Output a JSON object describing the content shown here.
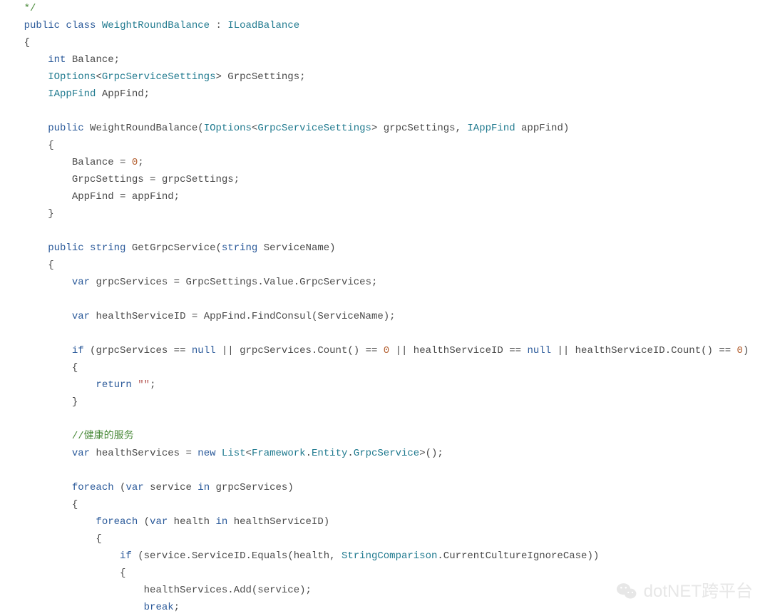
{
  "code": {
    "lines": [
      {
        "indent": "    ",
        "spans": [
          {
            "cls": "cmt",
            "t": "*/"
          }
        ]
      },
      {
        "indent": "    ",
        "spans": [
          {
            "cls": "kw",
            "t": "public"
          },
          {
            "cls": "punct",
            "t": " "
          },
          {
            "cls": "kw",
            "t": "class"
          },
          {
            "cls": "punct",
            "t": " "
          },
          {
            "cls": "type",
            "t": "WeightRoundBalance"
          },
          {
            "cls": "punct",
            "t": " : "
          },
          {
            "cls": "type",
            "t": "ILoadBalance"
          }
        ]
      },
      {
        "indent": "    ",
        "spans": [
          {
            "cls": "punct",
            "t": "{"
          }
        ]
      },
      {
        "indent": "        ",
        "spans": [
          {
            "cls": "kw",
            "t": "int"
          },
          {
            "cls": "punct",
            "t": " "
          },
          {
            "cls": "ident",
            "t": "Balance"
          },
          {
            "cls": "punct",
            "t": ";"
          }
        ]
      },
      {
        "indent": "        ",
        "spans": [
          {
            "cls": "type",
            "t": "IOptions"
          },
          {
            "cls": "punct",
            "t": "<"
          },
          {
            "cls": "type",
            "t": "GrpcServiceSettings"
          },
          {
            "cls": "punct",
            "t": "> "
          },
          {
            "cls": "ident",
            "t": "GrpcSettings"
          },
          {
            "cls": "punct",
            "t": ";"
          }
        ]
      },
      {
        "indent": "        ",
        "spans": [
          {
            "cls": "type",
            "t": "IAppFind"
          },
          {
            "cls": "punct",
            "t": " "
          },
          {
            "cls": "ident",
            "t": "AppFind"
          },
          {
            "cls": "punct",
            "t": ";"
          }
        ]
      },
      {
        "indent": "",
        "spans": []
      },
      {
        "indent": "        ",
        "spans": [
          {
            "cls": "kw",
            "t": "public"
          },
          {
            "cls": "punct",
            "t": " "
          },
          {
            "cls": "ident",
            "t": "WeightRoundBalance"
          },
          {
            "cls": "punct",
            "t": "("
          },
          {
            "cls": "type",
            "t": "IOptions"
          },
          {
            "cls": "punct",
            "t": "<"
          },
          {
            "cls": "type",
            "t": "GrpcServiceSettings"
          },
          {
            "cls": "punct",
            "t": "> "
          },
          {
            "cls": "ident",
            "t": "grpcSettings"
          },
          {
            "cls": "punct",
            "t": ", "
          },
          {
            "cls": "type",
            "t": "IAppFind"
          },
          {
            "cls": "punct",
            "t": " "
          },
          {
            "cls": "ident",
            "t": "appFind"
          },
          {
            "cls": "punct",
            "t": ")"
          }
        ]
      },
      {
        "indent": "        ",
        "spans": [
          {
            "cls": "punct",
            "t": "{"
          }
        ]
      },
      {
        "indent": "            ",
        "spans": [
          {
            "cls": "ident",
            "t": "Balance"
          },
          {
            "cls": "punct",
            "t": " = "
          },
          {
            "cls": "num",
            "t": "0"
          },
          {
            "cls": "punct",
            "t": ";"
          }
        ]
      },
      {
        "indent": "            ",
        "spans": [
          {
            "cls": "ident",
            "t": "GrpcSettings"
          },
          {
            "cls": "punct",
            "t": " = "
          },
          {
            "cls": "ident",
            "t": "grpcSettings"
          },
          {
            "cls": "punct",
            "t": ";"
          }
        ]
      },
      {
        "indent": "            ",
        "spans": [
          {
            "cls": "ident",
            "t": "AppFind"
          },
          {
            "cls": "punct",
            "t": " = "
          },
          {
            "cls": "ident",
            "t": "appFind"
          },
          {
            "cls": "punct",
            "t": ";"
          }
        ]
      },
      {
        "indent": "        ",
        "spans": [
          {
            "cls": "punct",
            "t": "}"
          }
        ]
      },
      {
        "indent": "",
        "spans": []
      },
      {
        "indent": "        ",
        "spans": [
          {
            "cls": "kw",
            "t": "public"
          },
          {
            "cls": "punct",
            "t": " "
          },
          {
            "cls": "kw",
            "t": "string"
          },
          {
            "cls": "punct",
            "t": " "
          },
          {
            "cls": "ident",
            "t": "GetGrpcService"
          },
          {
            "cls": "punct",
            "t": "("
          },
          {
            "cls": "kw",
            "t": "string"
          },
          {
            "cls": "punct",
            "t": " "
          },
          {
            "cls": "ident",
            "t": "ServiceName"
          },
          {
            "cls": "punct",
            "t": ")"
          }
        ]
      },
      {
        "indent": "        ",
        "spans": [
          {
            "cls": "punct",
            "t": "{"
          }
        ]
      },
      {
        "indent": "            ",
        "spans": [
          {
            "cls": "kw",
            "t": "var"
          },
          {
            "cls": "punct",
            "t": " "
          },
          {
            "cls": "ident",
            "t": "grpcServices"
          },
          {
            "cls": "punct",
            "t": " = "
          },
          {
            "cls": "ident",
            "t": "GrpcSettings"
          },
          {
            "cls": "punct",
            "t": "."
          },
          {
            "cls": "ident",
            "t": "Value"
          },
          {
            "cls": "punct",
            "t": "."
          },
          {
            "cls": "ident",
            "t": "GrpcServices"
          },
          {
            "cls": "punct",
            "t": ";"
          }
        ]
      },
      {
        "indent": "",
        "spans": []
      },
      {
        "indent": "            ",
        "spans": [
          {
            "cls": "kw",
            "t": "var"
          },
          {
            "cls": "punct",
            "t": " "
          },
          {
            "cls": "ident",
            "t": "healthServiceID"
          },
          {
            "cls": "punct",
            "t": " = "
          },
          {
            "cls": "ident",
            "t": "AppFind"
          },
          {
            "cls": "punct",
            "t": "."
          },
          {
            "cls": "ident",
            "t": "FindConsul"
          },
          {
            "cls": "punct",
            "t": "("
          },
          {
            "cls": "ident",
            "t": "ServiceName"
          },
          {
            "cls": "punct",
            "t": ");"
          }
        ]
      },
      {
        "indent": "",
        "spans": []
      },
      {
        "indent": "            ",
        "spans": [
          {
            "cls": "kw",
            "t": "if"
          },
          {
            "cls": "punct",
            "t": " ("
          },
          {
            "cls": "ident",
            "t": "grpcServices"
          },
          {
            "cls": "punct",
            "t": " == "
          },
          {
            "cls": "kw",
            "t": "null"
          },
          {
            "cls": "punct",
            "t": " || "
          },
          {
            "cls": "ident",
            "t": "grpcServices"
          },
          {
            "cls": "punct",
            "t": "."
          },
          {
            "cls": "ident",
            "t": "Count"
          },
          {
            "cls": "punct",
            "t": "() == "
          },
          {
            "cls": "num",
            "t": "0"
          },
          {
            "cls": "punct",
            "t": " || "
          },
          {
            "cls": "ident",
            "t": "healthServiceID"
          },
          {
            "cls": "punct",
            "t": " == "
          },
          {
            "cls": "kw",
            "t": "null"
          },
          {
            "cls": "punct",
            "t": " || "
          },
          {
            "cls": "ident",
            "t": "healthServiceID"
          },
          {
            "cls": "punct",
            "t": "."
          },
          {
            "cls": "ident",
            "t": "Count"
          },
          {
            "cls": "punct",
            "t": "() == "
          },
          {
            "cls": "num",
            "t": "0"
          },
          {
            "cls": "punct",
            "t": ")"
          }
        ]
      },
      {
        "indent": "            ",
        "spans": [
          {
            "cls": "punct",
            "t": "{"
          }
        ]
      },
      {
        "indent": "                ",
        "spans": [
          {
            "cls": "kw",
            "t": "return"
          },
          {
            "cls": "punct",
            "t": " "
          },
          {
            "cls": "str",
            "t": "\"\""
          },
          {
            "cls": "punct",
            "t": ";"
          }
        ]
      },
      {
        "indent": "            ",
        "spans": [
          {
            "cls": "punct",
            "t": "}"
          }
        ]
      },
      {
        "indent": "",
        "spans": []
      },
      {
        "indent": "            ",
        "spans": [
          {
            "cls": "cmt",
            "t": "//健康的服务"
          }
        ]
      },
      {
        "indent": "            ",
        "spans": [
          {
            "cls": "kw",
            "t": "var"
          },
          {
            "cls": "punct",
            "t": " "
          },
          {
            "cls": "ident",
            "t": "healthServices"
          },
          {
            "cls": "punct",
            "t": " = "
          },
          {
            "cls": "kw",
            "t": "new"
          },
          {
            "cls": "punct",
            "t": " "
          },
          {
            "cls": "type",
            "t": "List"
          },
          {
            "cls": "punct",
            "t": "<"
          },
          {
            "cls": "type",
            "t": "Framework"
          },
          {
            "cls": "punct",
            "t": "."
          },
          {
            "cls": "type",
            "t": "Entity"
          },
          {
            "cls": "punct",
            "t": "."
          },
          {
            "cls": "type",
            "t": "GrpcService"
          },
          {
            "cls": "punct",
            "t": ">();"
          }
        ]
      },
      {
        "indent": "",
        "spans": []
      },
      {
        "indent": "            ",
        "spans": [
          {
            "cls": "kw",
            "t": "foreach"
          },
          {
            "cls": "punct",
            "t": " ("
          },
          {
            "cls": "kw",
            "t": "var"
          },
          {
            "cls": "punct",
            "t": " "
          },
          {
            "cls": "ident",
            "t": "service"
          },
          {
            "cls": "punct",
            "t": " "
          },
          {
            "cls": "kw",
            "t": "in"
          },
          {
            "cls": "punct",
            "t": " "
          },
          {
            "cls": "ident",
            "t": "grpcServices"
          },
          {
            "cls": "punct",
            "t": ")"
          }
        ]
      },
      {
        "indent": "            ",
        "spans": [
          {
            "cls": "punct",
            "t": "{"
          }
        ]
      },
      {
        "indent": "                ",
        "spans": [
          {
            "cls": "kw",
            "t": "foreach"
          },
          {
            "cls": "punct",
            "t": " ("
          },
          {
            "cls": "kw",
            "t": "var"
          },
          {
            "cls": "punct",
            "t": " "
          },
          {
            "cls": "ident",
            "t": "health"
          },
          {
            "cls": "punct",
            "t": " "
          },
          {
            "cls": "kw",
            "t": "in"
          },
          {
            "cls": "punct",
            "t": " "
          },
          {
            "cls": "ident",
            "t": "healthServiceID"
          },
          {
            "cls": "punct",
            "t": ")"
          }
        ]
      },
      {
        "indent": "                ",
        "spans": [
          {
            "cls": "punct",
            "t": "{"
          }
        ]
      },
      {
        "indent": "                    ",
        "spans": [
          {
            "cls": "kw",
            "t": "if"
          },
          {
            "cls": "punct",
            "t": " ("
          },
          {
            "cls": "ident",
            "t": "service"
          },
          {
            "cls": "punct",
            "t": "."
          },
          {
            "cls": "ident",
            "t": "ServiceID"
          },
          {
            "cls": "punct",
            "t": "."
          },
          {
            "cls": "ident",
            "t": "Equals"
          },
          {
            "cls": "punct",
            "t": "("
          },
          {
            "cls": "ident",
            "t": "health"
          },
          {
            "cls": "punct",
            "t": ", "
          },
          {
            "cls": "type",
            "t": "StringComparison"
          },
          {
            "cls": "punct",
            "t": "."
          },
          {
            "cls": "ident",
            "t": "CurrentCultureIgnoreCase"
          },
          {
            "cls": "punct",
            "t": "))"
          }
        ]
      },
      {
        "indent": "                    ",
        "spans": [
          {
            "cls": "punct",
            "t": "{"
          }
        ]
      },
      {
        "indent": "                        ",
        "spans": [
          {
            "cls": "ident",
            "t": "healthServices"
          },
          {
            "cls": "punct",
            "t": "."
          },
          {
            "cls": "ident",
            "t": "Add"
          },
          {
            "cls": "punct",
            "t": "("
          },
          {
            "cls": "ident",
            "t": "service"
          },
          {
            "cls": "punct",
            "t": ");"
          }
        ]
      },
      {
        "indent": "                        ",
        "spans": [
          {
            "cls": "kw",
            "t": "break"
          },
          {
            "cls": "punct",
            "t": ";"
          }
        ]
      }
    ]
  },
  "watermark": {
    "text": "dotNET跨平台"
  }
}
